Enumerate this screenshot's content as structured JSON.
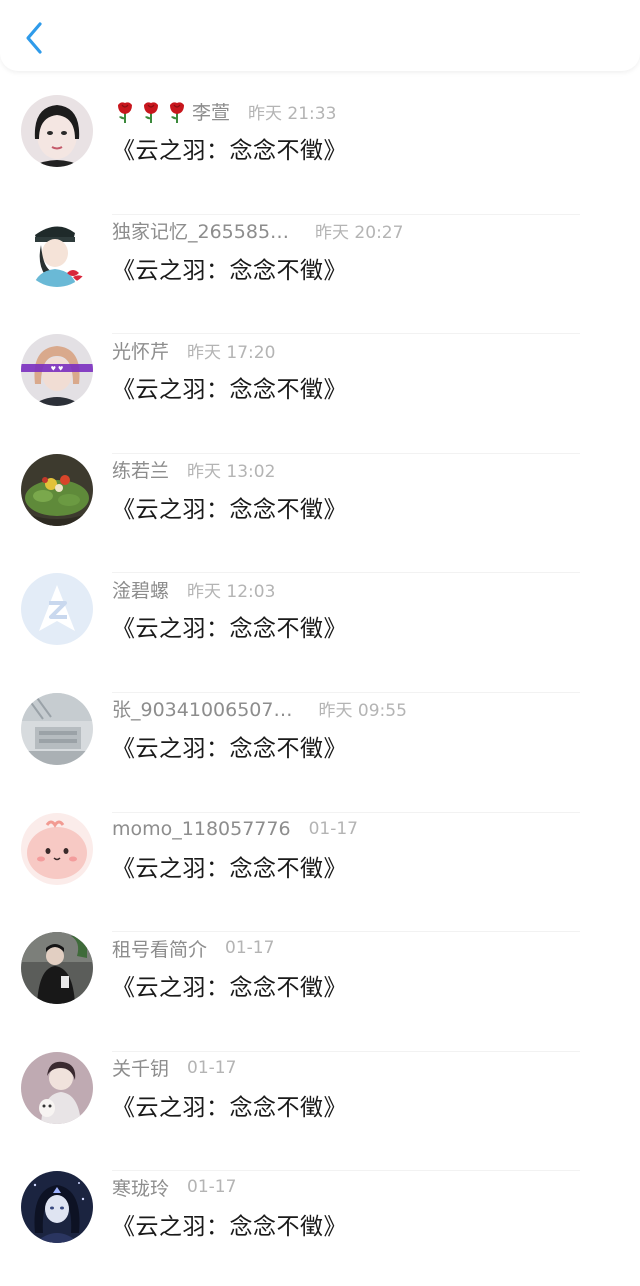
{
  "header": {
    "back_icon": "chevron-left-icon",
    "accent_color": "#2f9bea"
  },
  "comments": [
    {
      "name": "李萱",
      "time": "昨天 21:33",
      "message": "《云之羽：念念不徵》",
      "badge": "three-rose-icons",
      "avatar": "user-photo"
    },
    {
      "name": "独家记忆_265585…",
      "time": "昨天 20:27",
      "message": "《云之羽：念念不徵》",
      "avatar": "user-illustration"
    },
    {
      "name": "光怀芹",
      "time": "昨天 17:20",
      "message": "《云之羽：念念不徵》",
      "avatar": "user-photo"
    },
    {
      "name": "练若兰",
      "time": "昨天 13:02",
      "message": "《云之羽：念念不徵》",
      "avatar": "food-photo"
    },
    {
      "name": "淦碧螺",
      "time": "昨天 12:03",
      "message": "《云之羽：念念不徵》",
      "avatar": "default-avatar-z-logo"
    },
    {
      "name": "张_90341006507…",
      "time": "昨天 09:55",
      "message": "《云之羽：念念不徵》",
      "avatar": "scenery-photo"
    },
    {
      "name": "momo_118057776",
      "time": "01-17",
      "message": "《云之羽：念念不徵》",
      "avatar": "cartoon-blob"
    },
    {
      "name": "租号看简介",
      "time": "01-17",
      "message": "《云之羽：念念不徵》",
      "avatar": "user-photo"
    },
    {
      "name": "关千钥",
      "time": "01-17",
      "message": "《云之羽：念念不徵》",
      "avatar": "user-photo"
    },
    {
      "name": "寒珑玲",
      "time": "01-17",
      "message": "《云之羽：念念不徵》",
      "avatar": "anime-portrait"
    }
  ]
}
